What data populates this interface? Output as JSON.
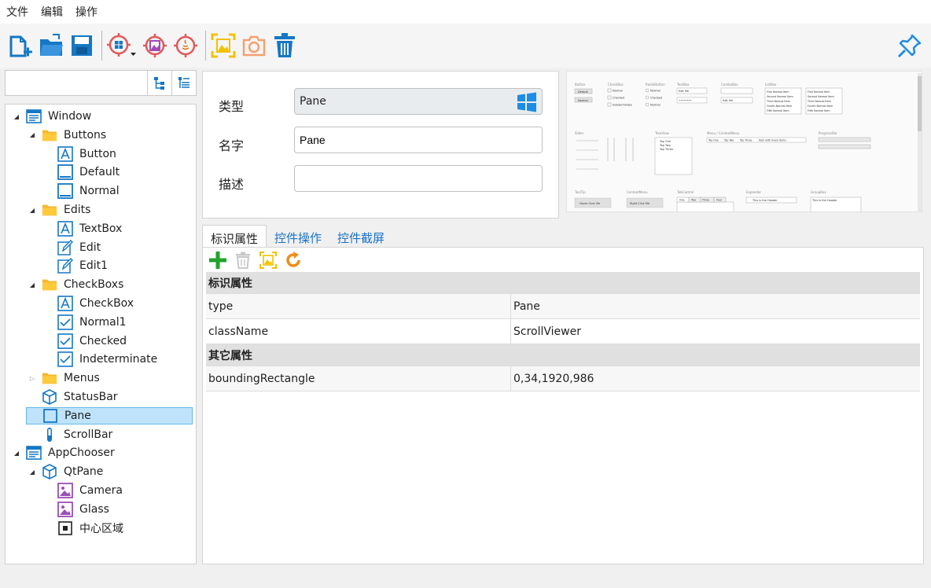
{
  "menu": {
    "file": "文件",
    "edit": "编辑",
    "ops": "操作"
  },
  "toolbar": {
    "icons": [
      "new-file-icon",
      "open-folder-icon",
      "save-icon",
      "target-windows-icon",
      "target-image-icon",
      "target-java-icon",
      "capture-region-icon",
      "camera-icon",
      "trash-icon",
      "pin-icon"
    ]
  },
  "search": {
    "value": "",
    "placeholder": ""
  },
  "tree": [
    {
      "label": "Window",
      "level": 0,
      "expanded": true,
      "icon": "window-icon"
    },
    {
      "label": "Buttons",
      "level": 1,
      "expanded": true,
      "icon": "folder-icon"
    },
    {
      "label": "Button",
      "level": 2,
      "icon": "text-a-icon"
    },
    {
      "label": "Default",
      "level": 2,
      "icon": "square-icon"
    },
    {
      "label": "Normal",
      "level": 2,
      "icon": "square-icon"
    },
    {
      "label": "Edits",
      "level": 1,
      "expanded": true,
      "icon": "folder-icon"
    },
    {
      "label": "TextBox",
      "level": 2,
      "icon": "text-a-icon"
    },
    {
      "label": "Edit",
      "level": 2,
      "icon": "edit-pencil-icon"
    },
    {
      "label": "Edit1",
      "level": 2,
      "icon": "edit-pencil-icon"
    },
    {
      "label": "CheckBoxs",
      "level": 1,
      "expanded": true,
      "icon": "folder-icon"
    },
    {
      "label": "CheckBox",
      "level": 2,
      "icon": "text-a-icon"
    },
    {
      "label": "Normal1",
      "level": 2,
      "icon": "checkbox-icon"
    },
    {
      "label": "Checked",
      "level": 2,
      "icon": "checkbox-icon"
    },
    {
      "label": "Indeterminate",
      "level": 2,
      "icon": "checkbox-icon"
    },
    {
      "label": "Menus",
      "level": 1,
      "expanded": false,
      "icon": "folder-icon"
    },
    {
      "label": "StatusBar",
      "level": 1,
      "icon": "cube-icon"
    },
    {
      "label": "Pane",
      "level": 1,
      "icon": "pane-square-icon",
      "selected": true
    },
    {
      "label": "ScrollBar",
      "level": 1,
      "icon": "scrollbar-icon"
    },
    {
      "label": "AppChooser",
      "level": 0,
      "expanded": true,
      "icon": "window-icon"
    },
    {
      "label": "QtPane",
      "level": 1,
      "expanded": true,
      "icon": "cube-icon"
    },
    {
      "label": "Camera",
      "level": 2,
      "icon": "image-icon"
    },
    {
      "label": "Glass",
      "level": 2,
      "icon": "image-icon"
    },
    {
      "label": "中心区域",
      "level": 2,
      "icon": "black-square-icon"
    }
  ],
  "form": {
    "type_label": "类型",
    "type_value": "Pane",
    "name_label": "名字",
    "name_value": "Pane",
    "desc_label": "描述",
    "desc_value": ""
  },
  "tabs": [
    "标识属性",
    "控件操作",
    "控件截屏"
  ],
  "grid": {
    "cat1": "标识属性",
    "rows1": [
      {
        "name": "type",
        "value": "Pane"
      },
      {
        "name": "className",
        "value": "ScrollViewer"
      }
    ],
    "cat2": "其它属性",
    "rows2": [
      {
        "name": "boundingRectangle",
        "value": "0,34,1920,986"
      }
    ]
  },
  "preview": {
    "sections": [
      "Button",
      "CheckBox",
      "RadioButton",
      "TextBox",
      "ComboBox",
      "ListBox",
      "Slider",
      "TreeView",
      "Menu / ContextMenu",
      "ProgressBar",
      "ToolTip",
      "ContextMenu",
      "TabControl",
      "Expander",
      "GroupBox"
    ],
    "buttons": [
      "Default",
      "Normal"
    ],
    "checks": [
      "Normal",
      "Checked",
      "Indeterminate"
    ],
    "radios": [
      "Normal",
      "Checked",
      "Normal"
    ],
    "textbox_value": "Edit Me",
    "password_value": "••••••••",
    "combo_value": "Edit Me",
    "list_items": [
      "First Normal Item",
      "Second Normal Item",
      "Third Normal Item",
      "Fourth Normal Item",
      "Fifth Normal Item"
    ],
    "tree_items": [
      "Top One",
      "Top Two",
      "Top Three"
    ],
    "menu_items": [
      "Top One",
      "Top Two",
      "Top Three",
      "Item with many items"
    ],
    "tooltip_btn": "Hover Over Me",
    "ctx_btn": "Right Click Me",
    "tab_items": [
      "One",
      "Two",
      "Three",
      "Four"
    ],
    "expander_header": "This is the Header",
    "groupbox_header": "This is the Header"
  },
  "colors": {
    "accent": "#1a73c8",
    "selection": "#bfe3fb"
  }
}
